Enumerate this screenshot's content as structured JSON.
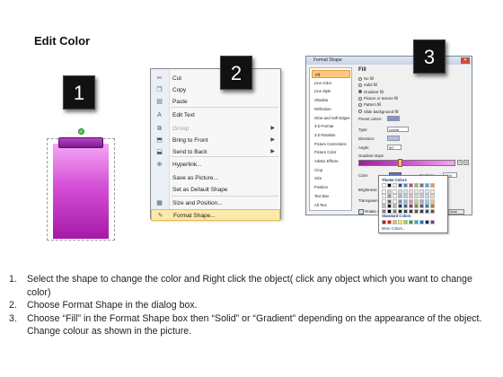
{
  "title": "Edit Color",
  "badges": [
    "1",
    "2",
    "3"
  ],
  "context_menu": {
    "items": [
      {
        "label": "Cut",
        "icon": "scissors-icon",
        "glyph": "✂",
        "disabled": false,
        "submenu": false
      },
      {
        "label": "Copy",
        "icon": "copy-icon",
        "glyph": "❐",
        "disabled": false,
        "submenu": false
      },
      {
        "label": "Paste",
        "icon": "paste-icon",
        "glyph": "▤",
        "disabled": false,
        "submenu": false
      },
      {
        "label": "Edit Text",
        "icon": "edit-text-icon",
        "glyph": "A",
        "disabled": false,
        "submenu": false
      },
      {
        "label": "Group",
        "icon": "group-icon",
        "glyph": "⧉",
        "disabled": true,
        "submenu": true
      },
      {
        "label": "Bring to Front",
        "icon": "bring-front-icon",
        "glyph": "⬒",
        "disabled": false,
        "submenu": true
      },
      {
        "label": "Send to Back",
        "icon": "send-back-icon",
        "glyph": "⬓",
        "disabled": false,
        "submenu": true
      },
      {
        "label": "Hyperlink...",
        "icon": "hyperlink-icon",
        "glyph": "⊕",
        "disabled": false,
        "submenu": false
      },
      {
        "label": "Save as Picture...",
        "icon": "",
        "glyph": "",
        "disabled": false,
        "submenu": false
      },
      {
        "label": "Set as Default Shape",
        "icon": "",
        "glyph": "",
        "disabled": false,
        "submenu": false
      },
      {
        "label": "Size and Position...",
        "icon": "size-icon",
        "glyph": "▦",
        "disabled": false,
        "submenu": false
      },
      {
        "label": "Format Shape...",
        "icon": "format-shape-icon",
        "glyph": "✎",
        "disabled": false,
        "submenu": false,
        "highlighted": true
      }
    ]
  },
  "format_dialog": {
    "title": "Format Shape",
    "close_glyph": "✕",
    "categories": [
      "Fill",
      "Line Color",
      "Line Style",
      "Shadow",
      "Reflection",
      "Glow and Soft Edges",
      "3-D Format",
      "3-D Rotation",
      "Picture Corrections",
      "Picture Color",
      "Artistic Effects",
      "Crop",
      "Size",
      "Position",
      "Text Box",
      "Alt Text"
    ],
    "selected_category": "Fill",
    "section_heading": "Fill",
    "fill_options": [
      {
        "label": "No fill",
        "selected": false
      },
      {
        "label": "Solid fill",
        "selected": false
      },
      {
        "label": "Gradient fill",
        "selected": true
      },
      {
        "label": "Picture or texture fill",
        "selected": false
      },
      {
        "label": "Pattern fill",
        "selected": false
      },
      {
        "label": "Slide background fill",
        "selected": false
      }
    ],
    "preset_colors_label": "Preset colors:",
    "type_label": "Type:",
    "type_value": "Linear",
    "direction_label": "Direction:",
    "angle_label": "Angle:",
    "angle_value": "90°",
    "gradient_stops_label": "Gradient stops",
    "color_label": "Color",
    "position_label": "Position:",
    "position_value": "41%",
    "brightness_label": "Brightness:",
    "transparency_label": "Transparency:",
    "rotate_label": "Rotate with shape",
    "close_button": "Close",
    "palette": {
      "theme_heading": "Theme Colors",
      "standard_heading": "Standard Colors",
      "more_colors": "More Colors...",
      "theme_top": [
        "#ffffff",
        "#000000",
        "#eeece1",
        "#1f497d",
        "#4f81bd",
        "#c0504d",
        "#9bbb59",
        "#8064a2",
        "#4bacc6",
        "#f79646"
      ],
      "standard": [
        "#c00000",
        "#ff0000",
        "#ffc000",
        "#ffff00",
        "#92d050",
        "#00b050",
        "#00b0f0",
        "#0070c0",
        "#002060",
        "#7030a0"
      ]
    }
  },
  "steps": [
    {
      "num": "1.",
      "text": "Select the shape to change the color and Right click the object( click any object which you want to change color)"
    },
    {
      "num": "2.",
      "text": "Choose Format Shape in the dialog box."
    },
    {
      "num": "3.",
      "text": "Choose “Fill” in the Format Shape box then “Solid” or “Gradient” depending on the appearance of the object. Change colour as shown in the picture."
    }
  ]
}
